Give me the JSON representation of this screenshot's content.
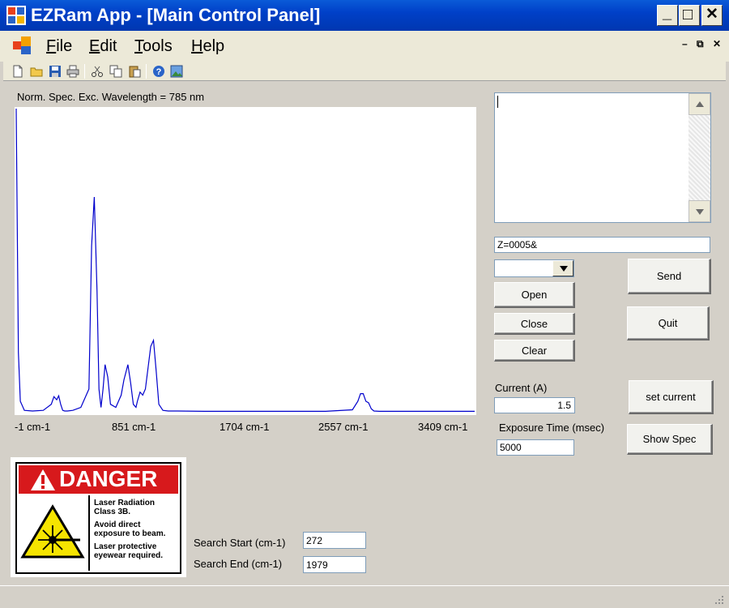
{
  "window": {
    "title": "EZRam App - [Main Control Panel]",
    "minimize_glyph": "_",
    "maximize_glyph": "□",
    "close_glyph": "✕"
  },
  "menu": {
    "items": [
      {
        "underline": "F",
        "rest": "ile"
      },
      {
        "underline": "E",
        "rest": "dit"
      },
      {
        "underline": "T",
        "rest": "ools"
      },
      {
        "underline": "H",
        "rest": "elp"
      }
    ],
    "mdi_minimize": "–",
    "mdi_restore": "⧉",
    "mdi_close": "✕"
  },
  "toolbar": {
    "icons": [
      "new-file-icon",
      "open-folder-icon",
      "save-icon",
      "print-icon",
      "cut-icon",
      "copy-icon",
      "paste-icon",
      "help-icon",
      "image-icon"
    ]
  },
  "spectrum": {
    "title": "Norm. Spec. Exc. Wavelength = 785 nm",
    "x_tick_labels": [
      "-1 cm-1",
      "851 cm-1",
      "1704 cm-1",
      "2557 cm-1",
      "3409 cm-1"
    ]
  },
  "chart_data": {
    "type": "line",
    "title": "Norm. Spec. Exc. Wavelength = 785 nm",
    "xlabel": "",
    "ylabel": "",
    "x_unit": "cm-1",
    "xlim": [
      -1,
      3409
    ],
    "ylim": [
      0,
      1
    ],
    "series": [
      {
        "color": "#0000cc",
        "x": [
          -1,
          15,
          30,
          60,
          120,
          200,
          260,
          280,
          300,
          315,
          330,
          345,
          360,
          380,
          420,
          480,
          540,
          560,
          580,
          600,
          615,
          630,
          645,
          660,
          680,
          700,
          740,
          780,
          800,
          830,
          850,
          870,
          890,
          900,
          920,
          940,
          960,
          980,
          1000,
          1020,
          1040,
          1060,
          1090,
          1130,
          1200,
          1400,
          1700,
          2000,
          2300,
          2500,
          2540,
          2560,
          2580,
          2600,
          2620,
          2640,
          2660,
          2700,
          2800,
          3000,
          3200,
          3409
        ],
        "y": [
          1.0,
          0.2,
          0.04,
          0.01,
          0.008,
          0.01,
          0.03,
          0.055,
          0.045,
          0.058,
          0.03,
          0.01,
          0.008,
          0.008,
          0.01,
          0.02,
          0.08,
          0.55,
          0.71,
          0.4,
          0.08,
          0.02,
          0.08,
          0.16,
          0.12,
          0.03,
          0.02,
          0.06,
          0.11,
          0.16,
          0.1,
          0.03,
          0.02,
          0.04,
          0.07,
          0.06,
          0.08,
          0.15,
          0.22,
          0.24,
          0.14,
          0.03,
          0.01,
          0.008,
          0.008,
          0.007,
          0.007,
          0.007,
          0.007,
          0.012,
          0.04,
          0.065,
          0.065,
          0.04,
          0.035,
          0.015,
          0.008,
          0.007,
          0.007,
          0.007,
          0.007,
          0.007
        ]
      }
    ],
    "grid": false,
    "legend": "none"
  },
  "log": {
    "text": ""
  },
  "command": {
    "value": "Z=0005&"
  },
  "port_select": {
    "value": ""
  },
  "buttons": {
    "send": "Send",
    "quit": "Quit",
    "open": "Open",
    "close": "Close",
    "clear": "Clear",
    "set_current": "set current",
    "show_spec": "Show Spec"
  },
  "current": {
    "label": "Current (A)",
    "value": "1.5"
  },
  "exposure": {
    "label": "Exposure Time (msec)",
    "value": "5000"
  },
  "search": {
    "start_label": "Search Start (cm-1)",
    "start_value": "272",
    "end_label": "Search End (cm-1)",
    "end_value": "1979"
  },
  "danger": {
    "header": "DANGER",
    "line1": "Laser Radiation",
    "line2": "Class 3B.",
    "line3": "Avoid direct",
    "line4": "exposure to beam.",
    "line5": "Laser protective",
    "line6": "eyewear required.",
    "red": "#d7191c",
    "yellow": "#f5e400"
  }
}
